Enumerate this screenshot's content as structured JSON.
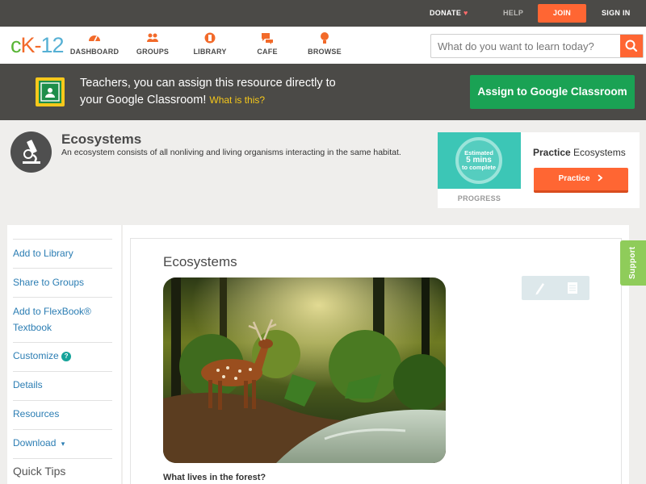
{
  "topbar": {
    "donate": "DONATE",
    "help": "HELP",
    "join": "JOIN",
    "signin": "SIGN IN"
  },
  "nav": {
    "logo": {
      "c": "c",
      "k": "K",
      "dash": "-",
      "num": "12"
    },
    "items": [
      {
        "label": "DASHBOARD",
        "icon": "dashboard-icon"
      },
      {
        "label": "GROUPS",
        "icon": "groups-icon"
      },
      {
        "label": "LIBRARY",
        "icon": "library-icon"
      },
      {
        "label": "CAFE",
        "icon": "cafe-icon"
      },
      {
        "label": "BROWSE",
        "icon": "browse-icon"
      }
    ],
    "search_placeholder": "What do you want to learn today?"
  },
  "teacher_banner": {
    "line1": "Teachers, you can assign this resource directly to",
    "line2": "your Google Classroom!",
    "what_is": "What is this?",
    "assign_button": "Assign to Google Classroom"
  },
  "concept": {
    "title": "Ecosystems",
    "description": "An ecosystem consists of all nonliving and living organisms interacting in the same habitat."
  },
  "practice": {
    "progress_top": "Estimated",
    "progress_mid": "5 mins",
    "progress_bottom": "to complete",
    "progress_label": "PROGRESS",
    "title_bold": "Practice",
    "title_rest": "Ecosystems",
    "button": "Practice"
  },
  "sidebar": {
    "items": [
      {
        "label": "Add to Library"
      },
      {
        "label": "Share to Groups"
      },
      {
        "label": "Add to FlexBook® Textbook"
      },
      {
        "label": "Customize"
      },
      {
        "label": "Details"
      },
      {
        "label": "Resources"
      },
      {
        "label": "Download"
      }
    ],
    "customize_help": "?",
    "download_arrow": "▾",
    "quick_tips": "Quick Tips"
  },
  "article": {
    "title": "Ecosystems",
    "caption": "What lives in the forest?",
    "support": "Support"
  },
  "colors": {
    "accent_orange": "#ff6633",
    "google_green": "#1aa254",
    "dark_bar": "#4b4a47",
    "link_blue": "#2b7db3",
    "teal": "#3cc6b6"
  }
}
